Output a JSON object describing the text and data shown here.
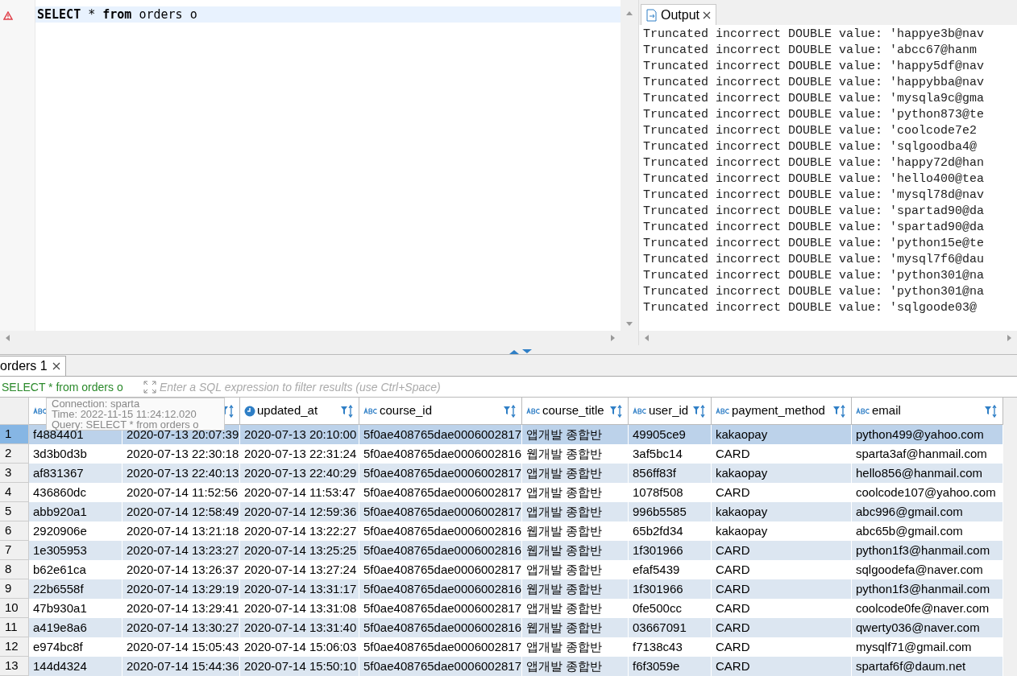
{
  "editor": {
    "lines": [
      {
        "text": "**SELECT** * **from** orders o",
        "error": true,
        "current": true
      }
    ]
  },
  "output": {
    "tab": {
      "label": "Output",
      "selected": true
    },
    "lines": [
      "Truncated incorrect DOUBLE value: 'happye3b@nav",
      "Truncated incorrect DOUBLE value: 'abcc67@hanm",
      "Truncated incorrect DOUBLE value: 'happy5df@nav",
      "Truncated incorrect DOUBLE value: 'happybba@nav",
      "Truncated incorrect DOUBLE value: 'mysqla9c@gma",
      "Truncated incorrect DOUBLE value: 'python873@te",
      "Truncated incorrect DOUBLE value: 'coolcode7e2",
      "Truncated incorrect DOUBLE value: 'sqlgoodba4@",
      "Truncated incorrect DOUBLE value: 'happy72d@han",
      "Truncated incorrect DOUBLE value: 'hello400@tea",
      "Truncated incorrect DOUBLE value: 'mysql78d@nav",
      "Truncated incorrect DOUBLE value: 'spartad90@da",
      "Truncated incorrect DOUBLE value: 'spartad90@da",
      "Truncated incorrect DOUBLE value: 'python15e@te",
      "Truncated incorrect DOUBLE value: 'mysql7f6@dau",
      "Truncated incorrect DOUBLE value: 'python301@na",
      "Truncated incorrect DOUBLE value: 'python301@na",
      "Truncated incorrect DOUBLE value: 'sqlgoode03@"
    ]
  },
  "results": {
    "tab": {
      "label": "orders 1",
      "selected": true
    },
    "filter": {
      "query": "SELECT * from orders o",
      "placeholder": "Enter a SQL expression to filter results (use Ctrl+Space)"
    },
    "tooltip": {
      "lines": [
        "Connection: sparta",
        "Time: 2022-11-15 11:24:12.020",
        "Query: SELECT * from orders o"
      ]
    },
    "columns": [
      {
        "kind": "text",
        "filter": false
      },
      {
        "filter": true
      },
      {
        "label": "updated_at",
        "kind": "datetime",
        "filter": true
      },
      {
        "label": "course_id",
        "kind": "text",
        "filter": true
      },
      {
        "label": "course_title",
        "kind": "text",
        "filter": true
      },
      {
        "label": "user_id",
        "kind": "text",
        "filter": true
      },
      {
        "label": "payment_method",
        "kind": "text",
        "filter": true
      },
      {
        "label": "email",
        "kind": "text",
        "filter": true
      }
    ],
    "rows": [
      {
        "number": "1",
        "selected": true,
        "cells": [
          "f4884401",
          "2020-07-13 20:07:39",
          "2020-07-13 20:10:00",
          "5f0ae408765dae0006002817",
          "앱개발 종합반",
          "49905ce9",
          "kakaopay",
          "python499@yahoo.com"
        ]
      },
      {
        "number": "2",
        "selected": false,
        "cells": [
          "3d3b0d3b",
          "2020-07-13 22:30:18",
          "2020-07-13 22:31:24",
          "5f0ae408765dae0006002816",
          "웹개발 종합반",
          "3af5bc14",
          "CARD",
          "sparta3af@hanmail.com"
        ]
      },
      {
        "number": "3",
        "selected": false,
        "cells": [
          "af831367",
          "2020-07-13 22:40:13",
          "2020-07-13 22:40:29",
          "5f0ae408765dae0006002817",
          "앱개발 종합반",
          "856ff83f",
          "kakaopay",
          "hello856@hanmail.com"
        ]
      },
      {
        "number": "4",
        "selected": false,
        "cells": [
          "436860dc",
          "2020-07-14 11:52:56",
          "2020-07-14 11:53:47",
          "5f0ae408765dae0006002817",
          "앱개발 종합반",
          "1078f508",
          "CARD",
          "coolcode107@yahoo.com"
        ]
      },
      {
        "number": "5",
        "selected": false,
        "cells": [
          "abb920a1",
          "2020-07-14 12:58:49",
          "2020-07-14 12:59:36",
          "5f0ae408765dae0006002817",
          "앱개발 종합반",
          "996b5585",
          "kakaopay",
          "abc996@gmail.com"
        ]
      },
      {
        "number": "6",
        "selected": false,
        "cells": [
          "2920906e",
          "2020-07-14 13:21:18",
          "2020-07-14 13:22:27",
          "5f0ae408765dae0006002816",
          "웹개발 종합반",
          "65b2fd34",
          "kakaopay",
          "abc65b@gmail.com"
        ]
      },
      {
        "number": "7",
        "selected": false,
        "cells": [
          "1e305953",
          "2020-07-14 13:23:27",
          "2020-07-14 13:25:25",
          "5f0ae408765dae0006002816",
          "웹개발 종합반",
          "1f301966",
          "CARD",
          "python1f3@hanmail.com"
        ]
      },
      {
        "number": "8",
        "selected": false,
        "cells": [
          "b62e61ca",
          "2020-07-14 13:26:37",
          "2020-07-14 13:27:24",
          "5f0ae408765dae0006002817",
          "앱개발 종합반",
          "efaf5439",
          "CARD",
          "sqlgoodefa@naver.com"
        ]
      },
      {
        "number": "9",
        "selected": false,
        "cells": [
          "22b6558f",
          "2020-07-14 13:29:19",
          "2020-07-14 13:31:17",
          "5f0ae408765dae0006002816",
          "웹개발 종합반",
          "1f301966",
          "CARD",
          "python1f3@hanmail.com"
        ]
      },
      {
        "number": "10",
        "selected": false,
        "cells": [
          "47b930a1",
          "2020-07-14 13:29:41",
          "2020-07-14 13:31:08",
          "5f0ae408765dae0006002817",
          "앱개발 종합반",
          "0fe500cc",
          "CARD",
          "coolcode0fe@naver.com"
        ]
      },
      {
        "number": "11",
        "selected": false,
        "cells": [
          "a419e8a6",
          "2020-07-14 13:30:27",
          "2020-07-14 13:31:40",
          "5f0ae408765dae0006002816",
          "웹개발 종합반",
          "03667091",
          "CARD",
          "qwerty036@naver.com"
        ]
      },
      {
        "number": "12",
        "selected": false,
        "cells": [
          "e974bc8f",
          "2020-07-14 15:05:43",
          "2020-07-14 15:06:03",
          "5f0ae408765dae0006002817",
          "앱개발 종합반",
          "f7138c43",
          "CARD",
          "mysqlf71@gmail.com"
        ]
      },
      {
        "number": "13",
        "selected": false,
        "cells": [
          "144d4324",
          "2020-07-14 15:44:36",
          "2020-07-14 15:50:10",
          "5f0ae408765dae0006002817",
          "앱개발 종합반",
          "f6f3059e",
          "CARD",
          "spartaf6f@daum.net"
        ]
      }
    ]
  }
}
